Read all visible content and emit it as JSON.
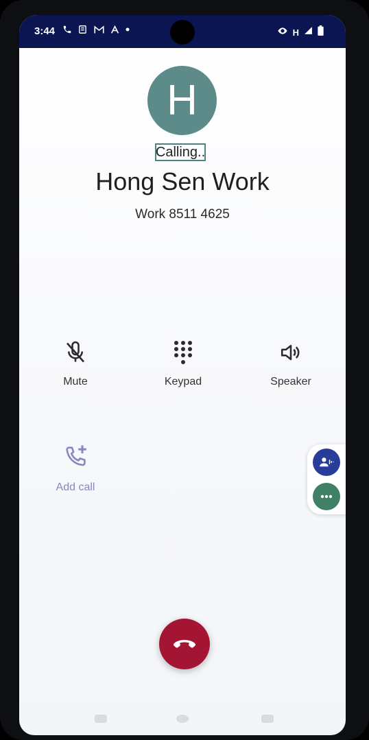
{
  "status_bar": {
    "time": "3:44",
    "network": "H",
    "left_icons": [
      "phone-icon",
      "news-icon",
      "gmail-icon",
      "arrow-a-icon",
      "dot-icon"
    ],
    "right_icons": [
      "eye-icon",
      "signal-icon",
      "battery-icon"
    ]
  },
  "call": {
    "avatar_letter": "H",
    "status": "Calling..",
    "contact_name": "Hong Sen Work",
    "number_label": "Work 8511 4625"
  },
  "controls": {
    "mute": "Mute",
    "keypad": "Keypad",
    "speaker": "Speaker",
    "add_call": "Add call"
  },
  "colors": {
    "status_bar": "#0b1552",
    "avatar": "#5d8b8a",
    "end_call": "#a41433",
    "side_top": "#283c9a",
    "side_bottom": "#3f8066"
  }
}
